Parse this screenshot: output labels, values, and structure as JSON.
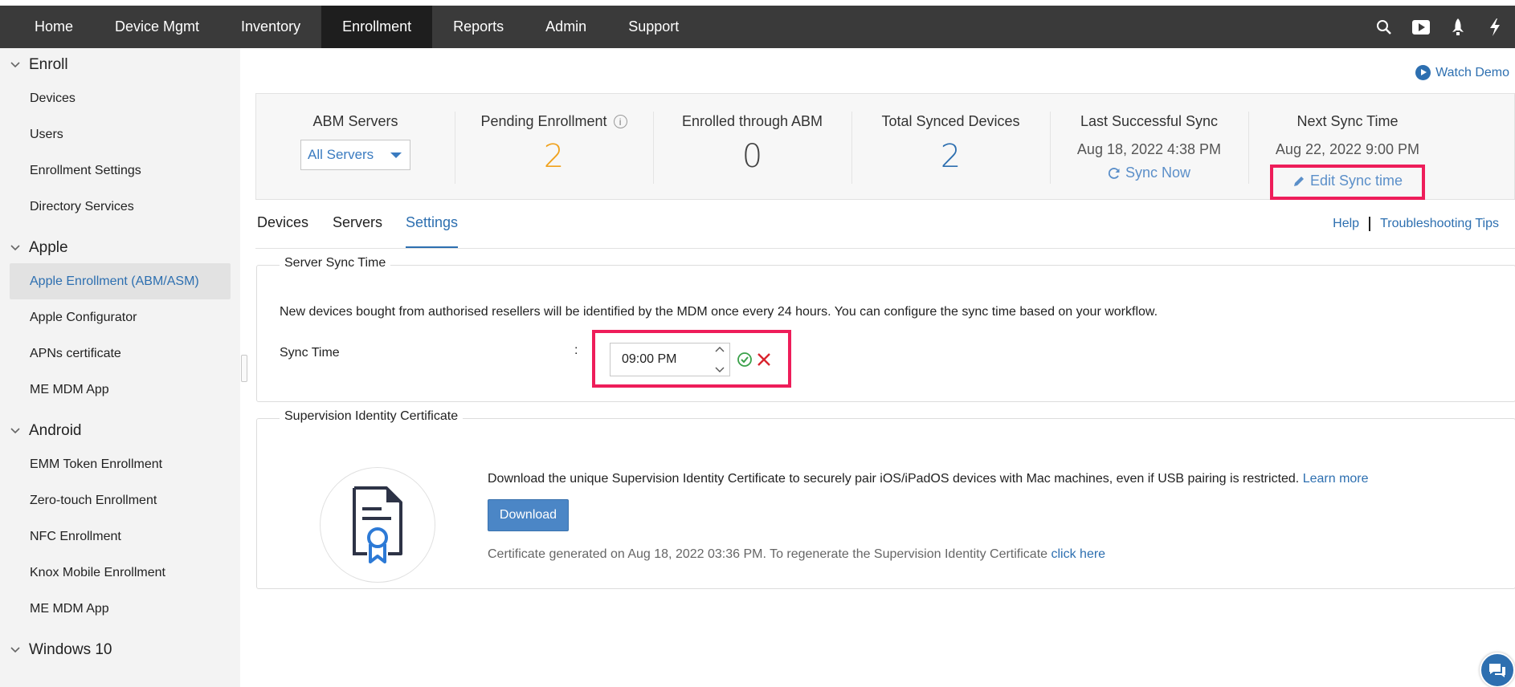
{
  "nav": {
    "items": [
      "Home",
      "Device Mgmt",
      "Inventory",
      "Enrollment",
      "Reports",
      "Admin",
      "Support"
    ],
    "active": "Enrollment",
    "icons": [
      "search-icon",
      "video-icon",
      "rocket-icon",
      "flash-icon"
    ]
  },
  "sidebar": {
    "sections": [
      {
        "title": "Enroll",
        "items": [
          "Devices",
          "Users",
          "Enrollment Settings",
          "Directory Services"
        ]
      },
      {
        "title": "Apple",
        "items": [
          "Apple Enrollment (ABM/ASM)",
          "Apple Configurator",
          "APNs certificate",
          "ME MDM App"
        ]
      },
      {
        "title": "Android",
        "items": [
          "EMM Token Enrollment",
          "Zero-touch Enrollment",
          "NFC Enrollment",
          "Knox Mobile Enrollment",
          "ME MDM App"
        ]
      },
      {
        "title": "Windows 10",
        "items": []
      }
    ],
    "active_item": "Apple Enrollment (ABM/ASM)"
  },
  "header": {
    "watch_demo": "Watch Demo"
  },
  "stats": {
    "abm_servers": {
      "label": "ABM Servers",
      "value": "All Servers"
    },
    "pending": {
      "label": "Pending Enrollment",
      "value": "2",
      "color": "#f0a21e"
    },
    "enrolled": {
      "label": "Enrolled through ABM",
      "value": "0",
      "color": "#444444"
    },
    "total": {
      "label": "Total Synced Devices",
      "value": "2",
      "color": "#2d6fb0"
    },
    "last_sync": {
      "label": "Last Successful Sync",
      "date": "Aug 18, 2022 4:38 PM",
      "action": "Sync Now"
    },
    "next_sync": {
      "label": "Next Sync Time",
      "date": "Aug 22, 2022 9:00 PM",
      "action": "Edit Sync time"
    }
  },
  "tabs": {
    "items": [
      "Devices",
      "Servers",
      "Settings"
    ],
    "active": "Settings",
    "help": "Help",
    "tips": "Troubleshooting Tips"
  },
  "sync_section": {
    "legend": "Server Sync Time",
    "description": "New devices bought from authorised resellers will be identified by the MDM once every 24 hours. You can configure the sync time based on your workflow.",
    "label": "Sync Time",
    "colon": ":",
    "value": "09:00 PM"
  },
  "cert_section": {
    "legend": "Supervision Identity Certificate",
    "description": "Download the unique Supervision Identity Certificate to securely pair iOS/iPadOS devices with Mac machines, even if USB pairing is restricted.",
    "learn_more": "Learn more",
    "download": "Download",
    "note": "Certificate generated on Aug 18, 2022 03:36 PM. To regenerate the Supervision Identity Certificate",
    "click_here": "click here"
  },
  "colors": {
    "topbar": "#3a3a3a",
    "accent": "#2d6fb0",
    "highlight": "#ee1d5a",
    "ok": "#3aa14a",
    "cancel": "#d9232e"
  }
}
